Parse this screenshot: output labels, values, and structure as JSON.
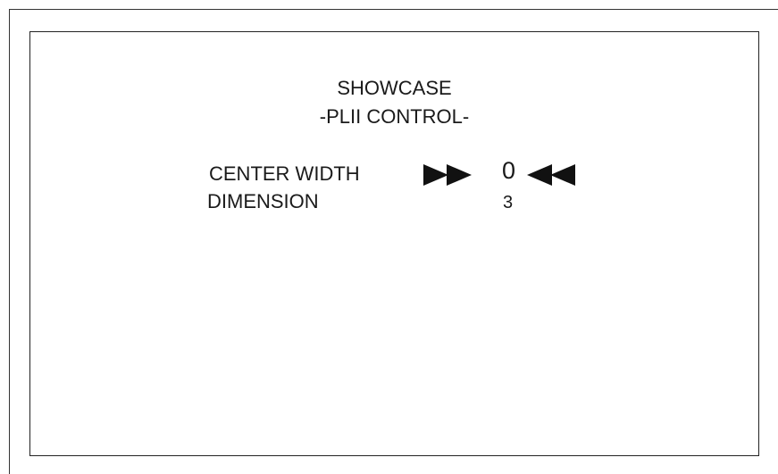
{
  "screen": {
    "title": "SHOWCASE",
    "subtitle": "-PLII CONTROL-"
  },
  "settings": [
    {
      "label": "CENTER WIDTH",
      "value": "0",
      "selected": true,
      "left_indicator_icon": "double-right-arrow-icon",
      "right_indicator_icon": "double-left-arrow-icon"
    },
    {
      "label": "DIMENSION",
      "value": "3",
      "selected": false
    }
  ],
  "colors": {
    "text": "#1a1a1a",
    "background": "#ffffff",
    "border": "#222222"
  }
}
